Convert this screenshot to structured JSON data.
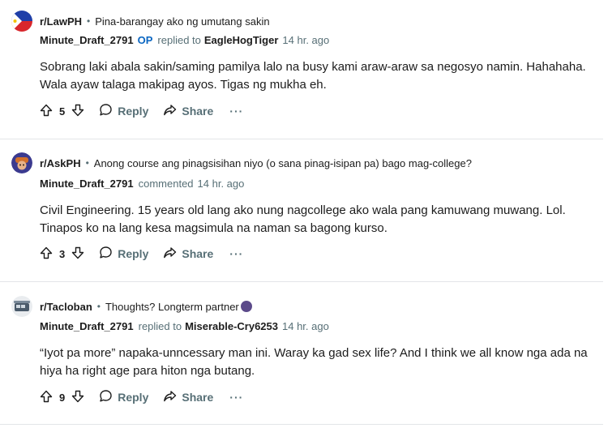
{
  "comments": [
    {
      "subreddit": "r/LawPH",
      "post_title": "Pina-barangay ako ng umutang sakin",
      "author": "Minute_Draft_2791",
      "op_badge": "OP",
      "action": "replied to",
      "target": "EagleHogTiger",
      "time": "14 hr. ago",
      "body_lines": [
        "Sobrang laki abala sakin/saming pamilya lalo na busy kami araw-araw sa negosyo namin. Hahahaha.",
        "Wala ayaw talaga makipag ayos. Tigas ng mukha eh."
      ],
      "votes": "5",
      "reply_label": "Reply",
      "share_label": "Share",
      "more": "···",
      "avatar_icon": "philippines-flag-avatar-icon"
    },
    {
      "subreddit": "r/AskPH",
      "post_title": "Anong course ang pinagsisihan niyo (o sana pinag-isipan pa) bago mag-college?",
      "author": "Minute_Draft_2791",
      "action": "commented",
      "time": "14 hr. ago",
      "body_lines": [
        "Civil Engineering. 15 years old lang ako nung nagcollege ako wala pang kamuwang muwang. Lol.",
        "Tinapos ko na lang kesa magsimula na naman sa bagong kurso."
      ],
      "votes": "3",
      "reply_label": "Reply",
      "share_label": "Share",
      "more": "···",
      "avatar_icon": "askph-avatar-icon"
    },
    {
      "subreddit": "r/Tacloban",
      "post_title": "Thoughts? Longterm partner",
      "author": "Minute_Draft_2791",
      "action": "replied to",
      "target": "Miserable-Cry6253",
      "time": "14 hr. ago",
      "body_lines": [
        "“Iyot pa more” napaka-unncessary man ini. Waray ka gad sex life? And I think we all know nga ada na",
        "hiya ha right age para hiton nga butang."
      ],
      "votes": "9",
      "reply_label": "Reply",
      "share_label": "Share",
      "more": "···",
      "avatar_icon": "tacloban-avatar-icon"
    }
  ]
}
